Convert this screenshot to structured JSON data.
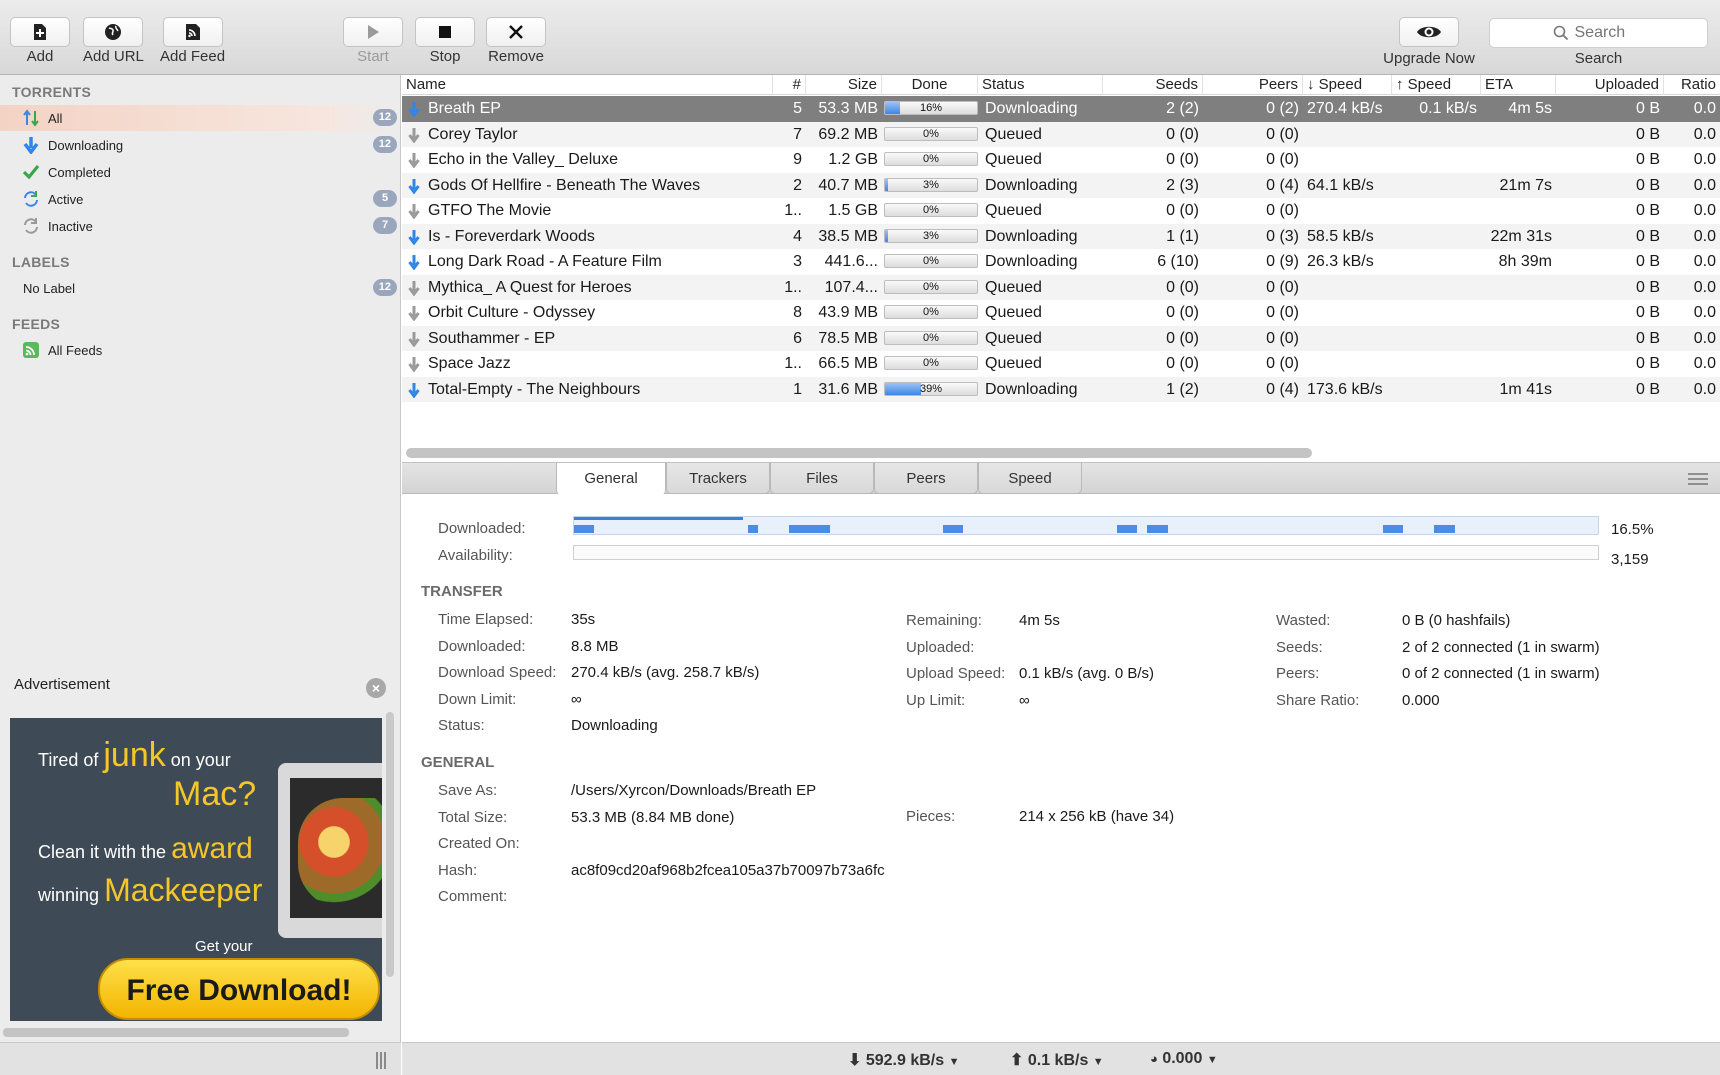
{
  "toolbar": {
    "add": "Add",
    "add_url": "Add URL",
    "add_feed": "Add Feed",
    "start": "Start",
    "stop": "Stop",
    "remove": "Remove",
    "upgrade": "Upgrade Now",
    "search_placeholder": "Search",
    "search_label": "Search"
  },
  "sidebar": {
    "torrents_header": "TORRENTS",
    "labels_header": "LABELS",
    "feeds_header": "FEEDS",
    "items": [
      {
        "label": "All",
        "count": "12",
        "icon": "sort-arrows-icon"
      },
      {
        "label": "Downloading",
        "count": "12",
        "icon": "download-arrow-icon"
      },
      {
        "label": "Completed",
        "count": "",
        "icon": "checkmark-icon"
      },
      {
        "label": "Active",
        "count": "5",
        "icon": "active-arrows-icon"
      },
      {
        "label": "Inactive",
        "count": "7",
        "icon": "inactive-arrows-icon"
      }
    ],
    "labels": [
      {
        "label": "No Label",
        "count": "12"
      }
    ],
    "feeds": [
      {
        "label": "All Feeds",
        "icon": "rss-icon"
      }
    ]
  },
  "ad": {
    "header": "Advertisement",
    "line1a": "Tired of",
    "line1b": "junk",
    "line1c": "on your",
    "line1d": "Mac?",
    "line2a": "Clean it with the",
    "line2b": "award",
    "line2c": "winning",
    "line2d": "Mackeeper",
    "getyour": "Get your",
    "cta": "Free Download!"
  },
  "columns": {
    "name": "Name",
    "num": "#",
    "size": "Size",
    "done": "Done",
    "status": "Status",
    "seeds": "Seeds",
    "peers": "Peers",
    "down": "↓ Speed",
    "up": "↑ Speed",
    "eta": "ETA",
    "uploaded": "Uploaded",
    "ratio": "Ratio"
  },
  "torrents": [
    {
      "name": "Breath EP",
      "num": "5",
      "size": "53.3 MB",
      "done": 16,
      "done_text": "16%",
      "status": "Downloading",
      "seeds": "2 (2)",
      "peers": "0 (2)",
      "down": "270.4 kB/s",
      "up": "0.1 kB/s",
      "eta": "4m 5s",
      "uploaded": "0 B",
      "ratio": "0.0"
    },
    {
      "name": "Corey Taylor",
      "num": "7",
      "size": "69.2 MB",
      "done": 0,
      "done_text": "0%",
      "status": "Queued",
      "seeds": "0 (0)",
      "peers": "0 (0)",
      "down": "",
      "up": "",
      "eta": "",
      "uploaded": "0 B",
      "ratio": "0.0"
    },
    {
      "name": "Echo in the Valley_ Deluxe",
      "num": "9",
      "size": "1.2 GB",
      "done": 0,
      "done_text": "0%",
      "status": "Queued",
      "seeds": "0 (0)",
      "peers": "0 (0)",
      "down": "",
      "up": "",
      "eta": "",
      "uploaded": "0 B",
      "ratio": "0.0"
    },
    {
      "name": "Gods Of Hellfire - Beneath The Waves",
      "num": "2",
      "size": "40.7 MB",
      "done": 3,
      "done_text": "3%",
      "status": "Downloading",
      "seeds": "2 (3)",
      "peers": "0 (4)",
      "down": "64.1 kB/s",
      "up": "",
      "eta": "21m 7s",
      "uploaded": "0 B",
      "ratio": "0.0"
    },
    {
      "name": "GTFO The Movie",
      "num": "1..",
      "size": "1.5 GB",
      "done": 0,
      "done_text": "0%",
      "status": "Queued",
      "seeds": "0 (0)",
      "peers": "0 (0)",
      "down": "",
      "up": "",
      "eta": "",
      "uploaded": "0 B",
      "ratio": "0.0"
    },
    {
      "name": "Is - Foreverdark Woods",
      "num": "4",
      "size": "38.5 MB",
      "done": 3,
      "done_text": "3%",
      "status": "Downloading",
      "seeds": "1 (1)",
      "peers": "0 (3)",
      "down": "58.5 kB/s",
      "up": "",
      "eta": "22m 31s",
      "uploaded": "0 B",
      "ratio": "0.0"
    },
    {
      "name": "Long Dark Road - A Feature Film",
      "num": "3",
      "size": "441.6...",
      "done": 0,
      "done_text": "0%",
      "status": "Downloading",
      "seeds": "6 (10)",
      "peers": "0 (9)",
      "down": "26.3 kB/s",
      "up": "",
      "eta": "8h 39m",
      "uploaded": "0 B",
      "ratio": "0.0"
    },
    {
      "name": "Mythica_ A Quest for Heroes",
      "num": "1..",
      "size": "107.4...",
      "done": 0,
      "done_text": "0%",
      "status": "Queued",
      "seeds": "0 (0)",
      "peers": "0 (0)",
      "down": "",
      "up": "",
      "eta": "",
      "uploaded": "0 B",
      "ratio": "0.0"
    },
    {
      "name": "Orbit Culture - Odyssey",
      "num": "8",
      "size": "43.9 MB",
      "done": 0,
      "done_text": "0%",
      "status": "Queued",
      "seeds": "0 (0)",
      "peers": "0 (0)",
      "down": "",
      "up": "",
      "eta": "",
      "uploaded": "0 B",
      "ratio": "0.0"
    },
    {
      "name": "Southammer - EP",
      "num": "6",
      "size": "78.5 MB",
      "done": 0,
      "done_text": "0%",
      "status": "Queued",
      "seeds": "0 (0)",
      "peers": "0 (0)",
      "down": "",
      "up": "",
      "eta": "",
      "uploaded": "0 B",
      "ratio": "0.0"
    },
    {
      "name": "Space Jazz",
      "num": "1..",
      "size": "66.5 MB",
      "done": 0,
      "done_text": "0%",
      "status": "Queued",
      "seeds": "0 (0)",
      "peers": "0 (0)",
      "down": "",
      "up": "",
      "eta": "",
      "uploaded": "0 B",
      "ratio": "0.0"
    },
    {
      "name": "Total-Empty - The Neighbours",
      "num": "1",
      "size": "31.6 MB",
      "done": 39,
      "done_text": "39%",
      "status": "Downloading",
      "seeds": "1 (2)",
      "peers": "0 (4)",
      "down": "173.6 kB/s",
      "up": "",
      "eta": "1m 41s",
      "uploaded": "0 B",
      "ratio": "0.0"
    }
  ],
  "tabs": [
    "General",
    "Trackers",
    "Files",
    "Peers",
    "Speed"
  ],
  "details": {
    "downloaded_label": "Downloaded:",
    "downloaded_pct": "16.5%",
    "availability_label": "Availability:",
    "availability_val": "3,159",
    "transfer_header": "TRANSFER",
    "general_header": "GENERAL",
    "transfer": [
      {
        "label": "Time Elapsed:",
        "value": "35s"
      },
      {
        "label": "Downloaded:",
        "value": "8.8 MB"
      },
      {
        "label": "Download Speed:",
        "value": "270.4 kB/s (avg. 258.7 kB/s)"
      },
      {
        "label": "Down Limit:",
        "value": "∞"
      },
      {
        "label": "Status:",
        "value": "Downloading"
      }
    ],
    "transfer2": [
      {
        "label": "Remaining:",
        "value": "4m 5s"
      },
      {
        "label": "Uploaded:",
        "value": ""
      },
      {
        "label": "Upload Speed:",
        "value": "0.1 kB/s (avg. 0 B/s)"
      },
      {
        "label": "Up Limit:",
        "value": "∞"
      }
    ],
    "transfer3": [
      {
        "label": "Wasted:",
        "value": "0 B (0 hashfails)"
      },
      {
        "label": "Seeds:",
        "value": "2 of 2 connected (1 in swarm)"
      },
      {
        "label": "Peers:",
        "value": "0 of 2 connected (1 in swarm)"
      },
      {
        "label": "Share Ratio:",
        "value": "0.000"
      }
    ],
    "general": [
      {
        "label": "Save As:",
        "value": "/Users/Xyrcon/Downloads/Breath EP"
      },
      {
        "label": "Total Size:",
        "value": "53.3 MB (8.84 MB done)"
      },
      {
        "label": "Created On:",
        "value": ""
      },
      {
        "label": "Hash:",
        "value": "ac8f09cd20af968b2fcea105a37b70097b73a6fc"
      },
      {
        "label": "Comment:",
        "value": ""
      }
    ],
    "pieces_label": "Pieces:",
    "pieces_value": "214 x 256 kB (have 34)"
  },
  "statusbar": {
    "down": "592.9 kB/s",
    "up": "0.1 kB/s",
    "ratio": "0.000"
  },
  "colors": {
    "accent": "#3d86e6",
    "selected_row": "#7f7f7f",
    "sidebar_selected": "#f3d3c4"
  }
}
